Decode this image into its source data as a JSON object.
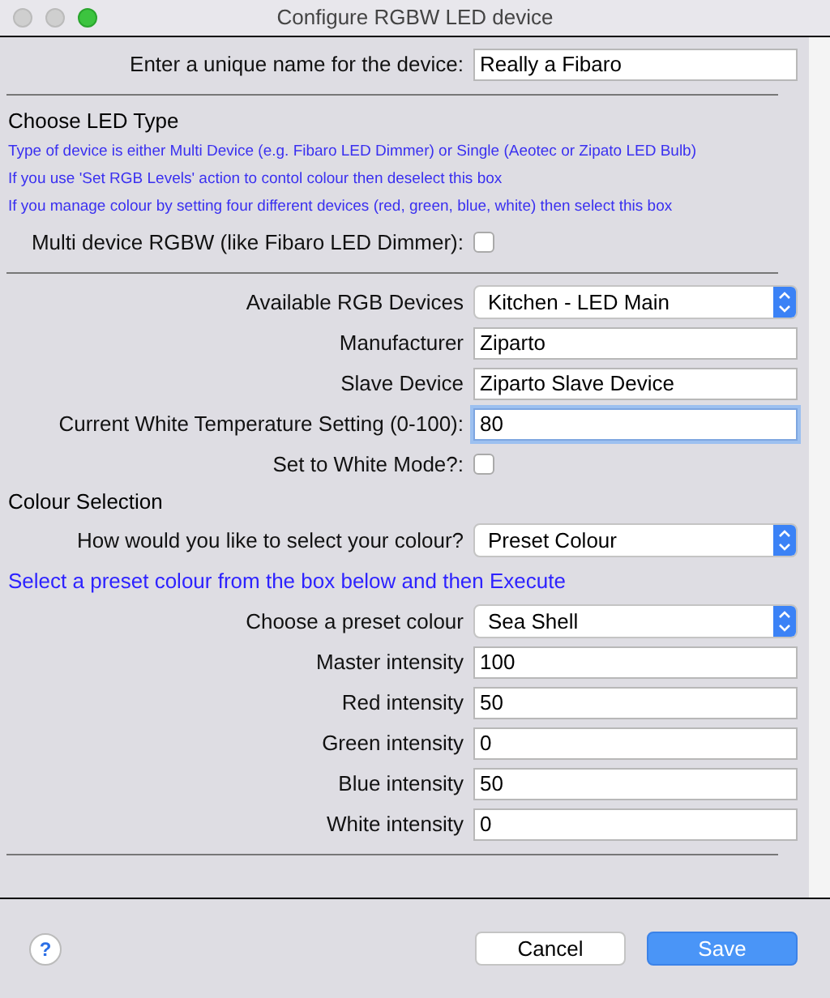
{
  "window": {
    "title": "Configure RGBW LED device"
  },
  "rows": [
    {
      "kind": "field",
      "label": "Enter a unique name for the device:",
      "value": "Really a Fibaro",
      "focused": false
    },
    {
      "kind": "separator"
    },
    {
      "kind": "heading",
      "text": "Choose LED Type"
    },
    {
      "kind": "note",
      "text": "Type of device is either Multi Device (e.g. Fibaro LED Dimmer) or Single (Aeotec or Zipato LED Bulb)"
    },
    {
      "kind": "note",
      "text": "If you use 'Set RGB Levels' action to contol colour then deselect this box"
    },
    {
      "kind": "note",
      "text": "If you manage colour by setting four different devices (red, green, blue, white) then select this box"
    },
    {
      "kind": "checkbox",
      "label": "Multi device RGBW (like Fibaro LED Dimmer):",
      "checked": false
    },
    {
      "kind": "separator"
    },
    {
      "kind": "select",
      "label": "Available RGB Devices",
      "value": "Kitchen - LED Main"
    },
    {
      "kind": "field",
      "label": "Manufacturer",
      "value": "Ziparto",
      "focused": false
    },
    {
      "kind": "field",
      "label": "Slave Device",
      "value": "Ziparto Slave Device",
      "focused": false
    },
    {
      "kind": "field",
      "label": "Current White Temperature Setting (0-100):",
      "value": "80",
      "focused": true
    },
    {
      "kind": "checkbox",
      "label": "Set to White Mode?:",
      "checked": false
    },
    {
      "kind": "heading",
      "text": "Colour Selection"
    },
    {
      "kind": "select",
      "label": "How would you like to select your colour?",
      "value": "Preset Colour"
    },
    {
      "kind": "info",
      "text": "Select a preset colour from the box below and then Execute"
    },
    {
      "kind": "select",
      "label": "Choose a preset colour",
      "value": "Sea Shell"
    },
    {
      "kind": "field",
      "label": "Master intensity",
      "value": "100",
      "focused": false
    },
    {
      "kind": "field",
      "label": "Red intensity",
      "value": "50",
      "focused": false
    },
    {
      "kind": "field",
      "label": "Green intensity",
      "value": "0",
      "focused": false
    },
    {
      "kind": "field",
      "label": "Blue intensity",
      "value": "50",
      "focused": false
    },
    {
      "kind": "field",
      "label": "White intensity",
      "value": "0",
      "focused": false
    },
    {
      "kind": "separator"
    }
  ],
  "buttons": [
    {
      "label": "Cancel",
      "kind": "secondary"
    },
    {
      "label": "Save",
      "kind": "primary"
    }
  ],
  "help": {
    "label": "?"
  }
}
